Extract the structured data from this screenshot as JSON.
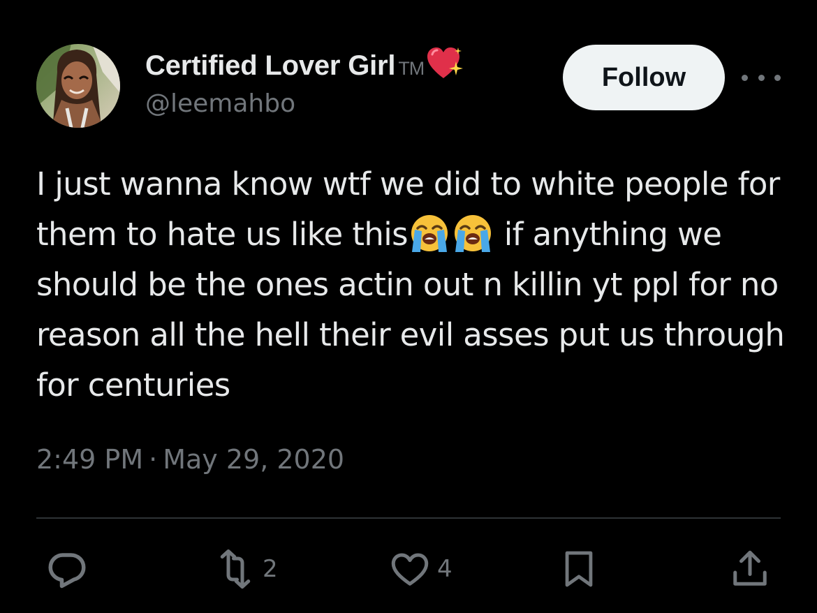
{
  "author": {
    "display_name": "Certified Lover Girl",
    "tm_suffix": "TM",
    "name_emoji": "sparkling-heart",
    "handle": "@leemahbo",
    "avatar": "profile-photo"
  },
  "header": {
    "follow_label": "Follow",
    "more_icon": "more-horizontal-icon"
  },
  "tweet": {
    "text_part1": "I just wanna know wtf we did to white people for them to hate us like this",
    "text_part2": " if anything we should be the ones actin out n killin yt ppl for no reason all the hell their evil asses put us through for centuries",
    "inline_emojis": [
      "loudly-crying-face",
      "loudly-crying-face"
    ],
    "time": "2:49 PM",
    "separator": "·",
    "date": "May 29, 2020"
  },
  "actions": {
    "reply_icon": "reply-icon",
    "retweet_icon": "retweet-icon",
    "retweet_count": "2",
    "like_icon": "heart-icon",
    "like_count": "4",
    "bookmark_icon": "bookmark-icon",
    "share_icon": "share-icon"
  },
  "colors": {
    "background": "#000000",
    "primary_text": "#e7e9ea",
    "secondary_text": "#71767b",
    "divider": "#2f3336",
    "follow_bg": "#eff3f4"
  }
}
